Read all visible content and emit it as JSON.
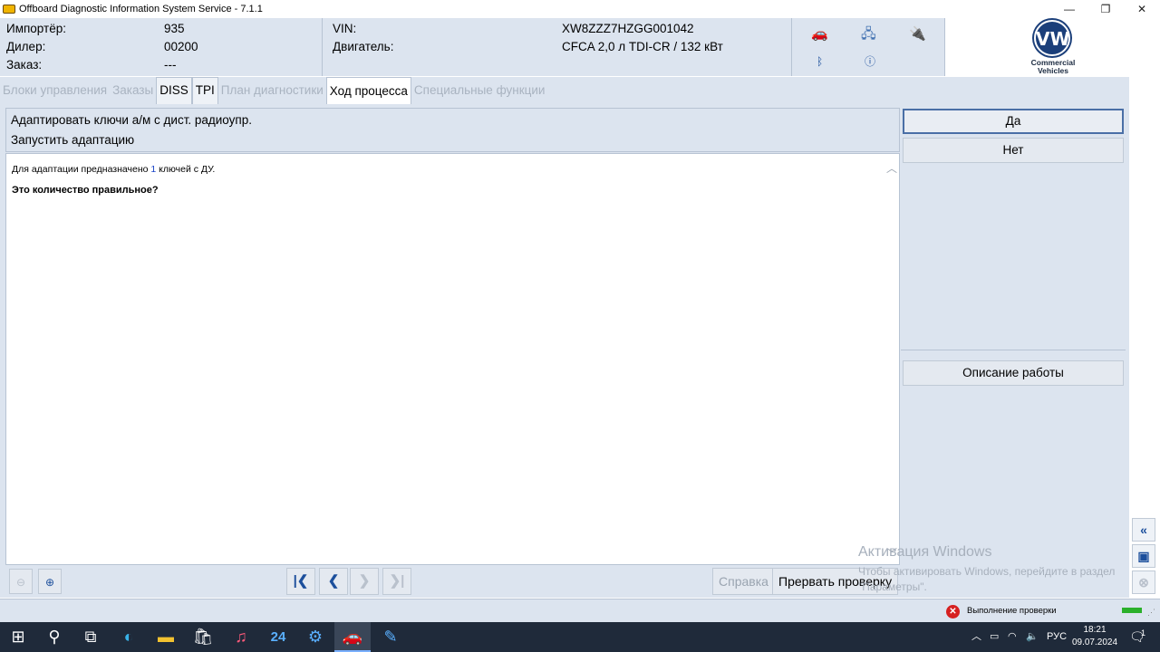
{
  "window": {
    "title": "Offboard Diagnostic Information System Service - 7.1.1",
    "minimize": "—",
    "restore": "❐",
    "close": "✕"
  },
  "header": {
    "importer_label": "Импортёр:",
    "importer_value": "935",
    "dealer_label": "Дилер:",
    "dealer_value": "00200",
    "order_label": "Заказ:",
    "order_value": "---",
    "vin_label": "VIN:",
    "vin_value": "XW8ZZZ7HZGG001042",
    "engine_label": "Двигатель:",
    "engine_value": "CFCA 2,0 л TDI-CR / 132 кВт",
    "logo_text_1": "Commercial",
    "logo_text_2": "Vehicles",
    "logo_initials": "VW"
  },
  "tabs": [
    {
      "label": "Блоки управления"
    },
    {
      "label": "Заказы"
    },
    {
      "label": "DISS"
    },
    {
      "label": "TPI"
    },
    {
      "label": "План диагностики"
    },
    {
      "label": "Ход процесса"
    },
    {
      "label": "Специальные функции"
    }
  ],
  "instruction": {
    "line1": "Адаптировать ключи а/м с дист. радиоупр.",
    "line2": "Запустить адаптацию"
  },
  "content": {
    "text_before": "Для адаптации предназначено ",
    "count": "1",
    "text_after": " ключей с ДУ.",
    "question": "Это количество правильное?"
  },
  "right_panel": {
    "yes_label": "Да",
    "no_label": "Нет",
    "description_label": "Описание работы"
  },
  "toolbar": {
    "help_label": "Справка",
    "abort_label": "Прервать проверку"
  },
  "watermark": {
    "title": "Активация Windows",
    "text": "Чтобы активировать Windows, перейдите в раздел \"Параметры\"."
  },
  "status": {
    "text": "Выполнение проверки"
  },
  "taskbar": {
    "app_24": "24",
    "language": "РУС",
    "time": "18:21",
    "date": "09.07.2024",
    "notification_count": "1"
  },
  "colors": {
    "panel_bg": "#dce4ef",
    "border": "#b7c3d3",
    "accent_blue": "#1c4f9c",
    "count_blue": "#1a44c8",
    "taskbar": "#1f2a3a"
  }
}
